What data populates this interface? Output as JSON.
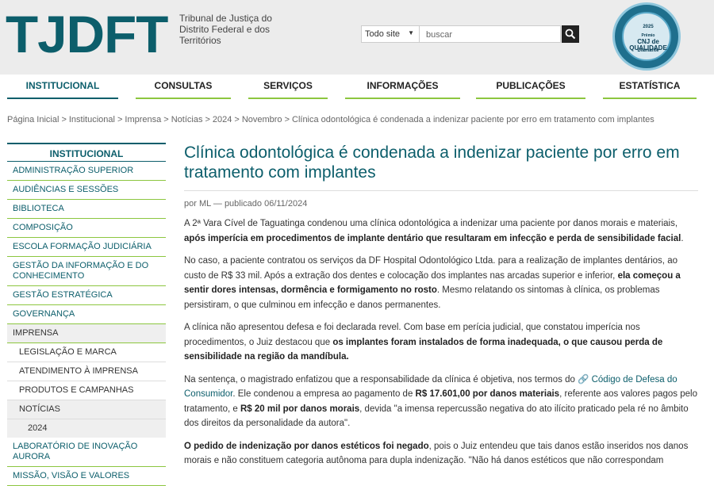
{
  "header": {
    "logo": "TJDFT",
    "subtitle": "Tribunal de Justiça do Distrito Federal e dos Territórios",
    "search_scope": "Todo site",
    "search_placeholder": "buscar",
    "seal": {
      "year": "2025",
      "line1": "Prêmio",
      "line2": "CNJ de QUALIDADE",
      "line3": "Diamante"
    }
  },
  "nav": {
    "items": [
      "INSTITUCIONAL",
      "CONSULTAS",
      "SERVIÇOS",
      "INFORMAÇÕES",
      "PUBLICAÇÕES",
      "ESTATÍSTICA"
    ]
  },
  "breadcrumb": [
    "Página Inicial",
    "Institucional",
    "Imprensa",
    "Notícias",
    "2024",
    "Novembro",
    "Clínica odontológica é condenada a indenizar paciente por erro em tratamento com implantes"
  ],
  "sidebar": {
    "heading": "INSTITUCIONAL",
    "items": [
      "ADMINISTRAÇÃO SUPERIOR",
      "AUDIÊNCIAS E SESSÕES",
      "BIBLIOTECA",
      "COMPOSIÇÃO",
      "ESCOLA FORMAÇÃO JUDICIÁRIA",
      "GESTÃO DA INFORMAÇÃO E DO CONHECIMENTO",
      "GESTÃO ESTRATÉGICA",
      "GOVERNANÇA",
      "IMPRENSA",
      "LEGISLAÇÃO E MARCA",
      "ATENDIMENTO À IMPRENSA",
      "PRODUTOS E CAMPANHAS",
      "NOTÍCIAS",
      "2024",
      "LABORATÓRIO DE INOVAÇÃO AURORA",
      "MISSÃO, VISÃO E VALORES"
    ]
  },
  "article": {
    "title": "Clínica odontológica é condenada a indenizar paciente por erro em tratamento com implantes",
    "byline": "por ML — publicado 06/11/2024",
    "p1a": "A 2ª Vara Cível de Taguatinga condenou uma clínica odontológica a indenizar uma paciente por danos morais e materiais, ",
    "p1b": "após imperícia em procedimentos de implante dentário que resultaram em infecção e perda de sensibilidade facial",
    "p1c": ".",
    "p2a": "No caso, a paciente contratou os serviços da DF Hospital Odontológico Ltda. para a realização de implantes dentários, ao custo de R$ 33 mil. Após a extração dos dentes e colocação dos implantes nas arcadas superior e inferior, ",
    "p2b": "ela começou a sentir dores intensas, dormência e formigamento no rosto",
    "p2c": ". Mesmo relatando os sintomas à clínica, os problemas persistiram, o que culminou em infecção e danos permanentes.",
    "p3a": "A clínica não apresentou defesa e foi declarada revel. Com base em perícia judicial, que constatou imperícia nos procedimentos, o Juiz destacou que ",
    "p3b": "os implantes foram instalados de forma inadequada, o que causou perda de sensibilidade na região da mandíbula.",
    "p4a": "Na sentença, o magistrado enfatizou que a responsabilidade da clínica é objetiva, nos termos do ",
    "p4link": "Código de Defesa do Consumidor",
    "p4b": ". Ele condenou a empresa ao pagamento de ",
    "p4c": "R$ 17.601,00 por danos materiais",
    "p4d": ", referente aos valores pagos pelo tratamento, e ",
    "p4e": "R$ 20 mil por danos morais",
    "p4f": ", devida \"a imensa repercussão negativa do ato ilícito praticado pela ré no âmbito dos direitos da personalidade da autora\".",
    "p5a": "O pedido de indenização por danos estéticos foi negado",
    "p5b": ", pois o Juiz entendeu que tais danos estão inseridos nos danos morais e não constituem categoria autônoma para dupla indenização. \"Não há danos estéticos que não correspondam"
  }
}
